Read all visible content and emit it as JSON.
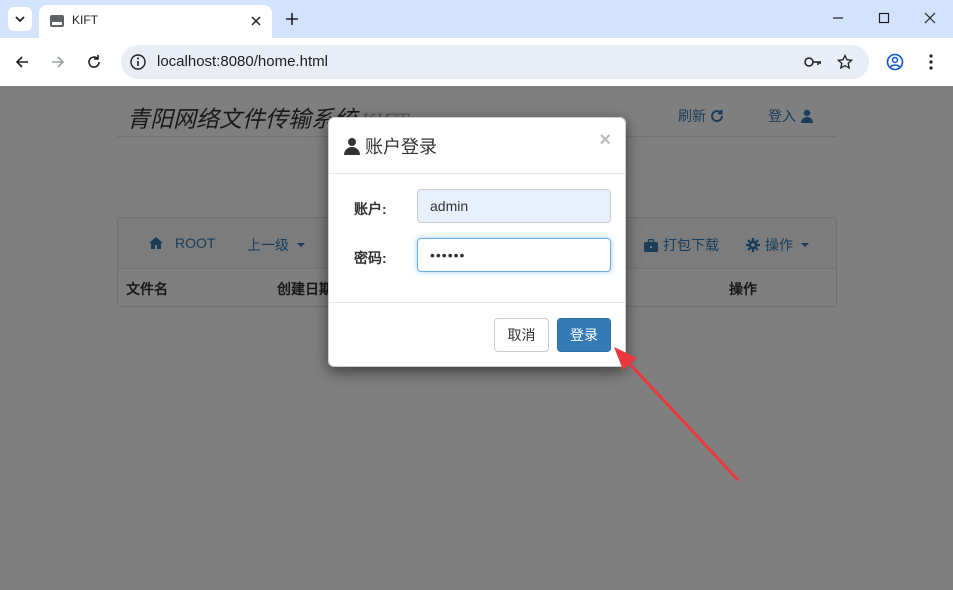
{
  "browser": {
    "tab_title": "KIFT",
    "url": "localhost:8080/home.html"
  },
  "page": {
    "site_title": "青阳网络文件传输系统",
    "site_subtitle": "KIFT",
    "refresh_label": "刷新",
    "login_link_label": "登入",
    "nav": {
      "root": "ROOT",
      "up": "上一级",
      "download": "打包下载",
      "actions": "操作"
    },
    "table_headers": {
      "filename": "文件名",
      "created": "创建日期",
      "actions": "操作"
    }
  },
  "modal": {
    "title": "账户登录",
    "close": "×",
    "account_label": "账户:",
    "account_value": "admin",
    "password_label": "密码:",
    "password_value": "••••••",
    "cancel_label": "取消",
    "login_label": "登录"
  },
  "colors": {
    "primary": "#337ab7",
    "arrow": "#e8383d"
  }
}
